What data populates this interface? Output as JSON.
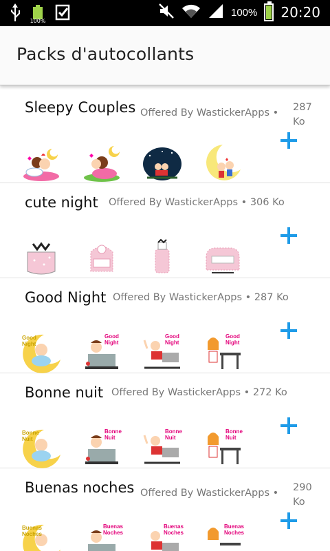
{
  "status_bar": {
    "battery_small_pct": "100%",
    "battery_pct": "100%",
    "time": "20:20"
  },
  "app_bar": {
    "title": "Packs d'autocollants"
  },
  "packs": [
    {
      "name": "Sleepy Couples",
      "publisher": "Offered By WastickerApps",
      "size": "287 Ko",
      "stickers": [
        "couple-sleeping",
        "couple-sleeping-2",
        "couple-night-sky",
        "couple-on-moon"
      ]
    },
    {
      "name": "cute night",
      "publisher": "Offered By WastickerApps",
      "size": "306 Ko",
      "stickers": [
        "pink-bag",
        "pink-chair",
        "pink-bottle",
        "pink-sofa"
      ]
    },
    {
      "name": "Good Night",
      "publisher": "Offered By WastickerApps",
      "size": "287 Ko",
      "stickers": [
        "baby-moon",
        "boy-desk",
        "boy-sleeping",
        "girl-desk"
      ],
      "caption": "Good Night"
    },
    {
      "name": "Bonne nuit",
      "publisher": "Offered By WastickerApps",
      "size": "272 Ko",
      "stickers": [
        "baby-moon",
        "boy-desk",
        "boy-sleeping",
        "girl-desk"
      ],
      "caption": "Bonne Nuit"
    },
    {
      "name": "Buenas noches",
      "publisher": "Offered By WastickerApps",
      "size": "290 Ko",
      "stickers": [
        "baby-moon",
        "boy-desk",
        "boy-sleeping",
        "girl-desk"
      ],
      "caption": "Buenas Noches"
    }
  ],
  "colors": {
    "add_icon": "#1e9be8",
    "status_bar_bg": "#000000",
    "app_bar_bg": "#fafafa",
    "divider": "#e0e0e0"
  }
}
